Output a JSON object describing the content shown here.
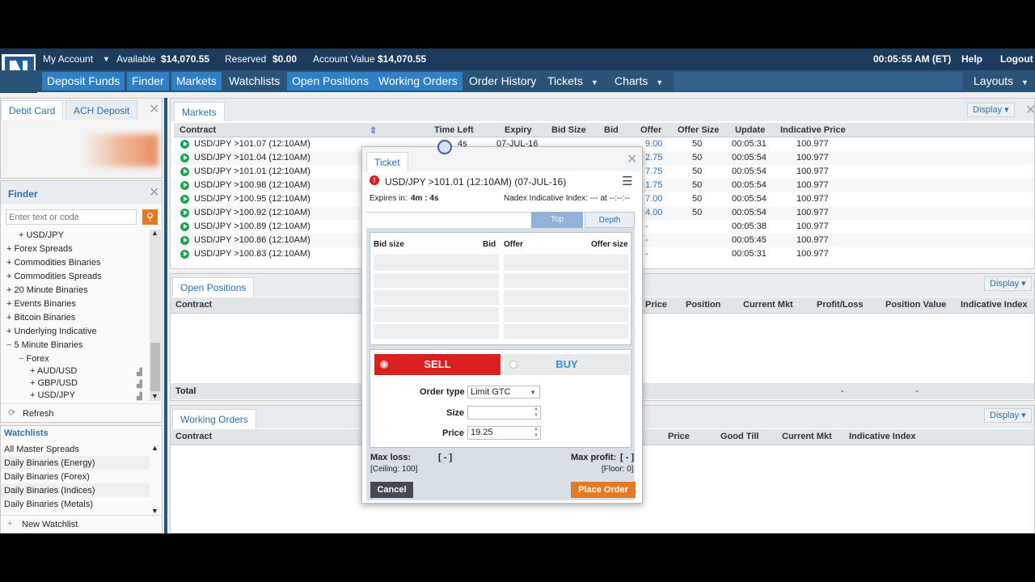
{
  "account": {
    "my_account": "My Account",
    "available_label": "Available",
    "available": "$14,070.55",
    "reserved_label": "Reserved",
    "reserved": "$0.00",
    "value_label": "Account Value",
    "value": "$14,070.55",
    "clock": "00:05:55 AM (ET)",
    "help": "Help",
    "logout": "Logout"
  },
  "nav": {
    "deposit": "Deposit Funds",
    "finder": "Finder",
    "markets": "Markets",
    "watchlists": "Watchlists",
    "open_positions": "Open Positions",
    "working_orders": "Working Orders",
    "order_history": "Order History",
    "tickets": "Tickets",
    "charts": "Charts",
    "layouts": "Layouts"
  },
  "deposit": {
    "tab1": "Debit Card",
    "tab2": "ACH Deposit"
  },
  "finder": {
    "title": "Finder",
    "placeholder": "Enter text or code",
    "items": [
      "USD/JPY",
      "Forex Spreads",
      "Commodities Binaries",
      "Commodities Spreads",
      "20 Minute Binaries",
      "Events Binaries",
      "Bitcoin Binaries",
      "Underlying Indicative",
      "5 Minute Binaries",
      "Forex",
      "AUD/USD",
      "GBP/USD",
      "USD/JPY"
    ],
    "refresh": "Refresh"
  },
  "watchlists": {
    "title": "Watchlists",
    "items": [
      "All Master Spreads",
      "Daily Binaries (Energy)",
      "Daily Binaries (Forex)",
      "Daily Binaries (Indices)",
      "Daily Binaries (Metals)"
    ],
    "new": "New Watchlist"
  },
  "markets": {
    "title": "Markets",
    "display": "Display",
    "cols": [
      "Contract",
      "Time Left",
      "Expiry",
      "Bid Size",
      "Bid",
      "Offer",
      "Offer Size",
      "Update",
      "Indicative Price"
    ],
    "rows": [
      {
        "contract": "USD/JPY >101.07 (12:10AM)",
        "time": "4s",
        "expiry": "07-JUL-16",
        "offer": "9.00",
        "offer_size": "50",
        "update": "00:05:31",
        "ind": "100.977"
      },
      {
        "contract": "USD/JPY >101.04 (12:10AM)",
        "offer": "2.75",
        "offer_size": "50",
        "update": "00:05:54",
        "ind": "100.977"
      },
      {
        "contract": "USD/JPY >101.01 (12:10AM)",
        "offer": "7.75",
        "offer_size": "50",
        "update": "00:05:54",
        "ind": "100.977"
      },
      {
        "contract": "USD/JPY >100.98 (12:10AM)",
        "offer": "1.75",
        "offer_size": "50",
        "update": "00:05:54",
        "ind": "100.977"
      },
      {
        "contract": "USD/JPY >100.95 (12:10AM)",
        "offer": "7.00",
        "offer_size": "50",
        "update": "00:05:54",
        "ind": "100.977"
      },
      {
        "contract": "USD/JPY >100.92 (12:10AM)",
        "offer": "4.00",
        "offer_size": "50",
        "update": "00:05:54",
        "ind": "100.977"
      },
      {
        "contract": "USD/JPY >100.89 (12:10AM)",
        "offer": "-",
        "offer_size": "",
        "update": "00:05:38",
        "ind": "100.977"
      },
      {
        "contract": "USD/JPY >100.86 (12:10AM)",
        "offer": "-",
        "offer_size": "",
        "update": "00:05:45",
        "ind": "100.977"
      },
      {
        "contract": "USD/JPY >100.83 (12:10AM)",
        "offer": "-",
        "offer_size": "",
        "update": "00:05:31",
        "ind": "100.977"
      }
    ]
  },
  "open_positions": {
    "title": "Open Positions",
    "display": "Display",
    "cols": [
      "Contract",
      "Price",
      "Position",
      "Current Mkt",
      "Profit/Loss",
      "Position Value",
      "Indicative Index"
    ],
    "total": "Total",
    "dash": "-"
  },
  "working_orders": {
    "title": "Working Orders",
    "display": "Display",
    "cols": [
      "Contract",
      "Price",
      "Good Till",
      "Current Mkt",
      "Indicative Index"
    ]
  },
  "ticket": {
    "tab": "Ticket",
    "contract": "USD/JPY >101.01 (12:10AM) (07-JUL-16)",
    "expires_label": "Expires in:",
    "expires": "4m : 4s",
    "nadex_index": "Nadex Indicative Index: --- at --:--:--",
    "top": "Top",
    "depth": "Depth",
    "book_cols": [
      "Bid size",
      "Bid",
      "Offer",
      "Offer size"
    ],
    "sell": "SELL",
    "buy": "BUY",
    "order_type_label": "Order type",
    "order_type": "Limit GTC",
    "size_label": "Size",
    "size": "",
    "price_label": "Price",
    "price": "19.25",
    "max_loss_label": "Max loss:",
    "max_loss": "[ - ]",
    "ceiling": "[Ceiling: 100]",
    "max_profit_label": "Max profit:",
    "max_profit": "[ - ]",
    "floor": "[Floor: 0]",
    "cancel": "Cancel",
    "place": "Place Order"
  },
  "colors": {
    "brand": "#1b3a5c",
    "accent": "#2e7fc4",
    "sell": "#d9201f",
    "place": "#e57a24"
  }
}
